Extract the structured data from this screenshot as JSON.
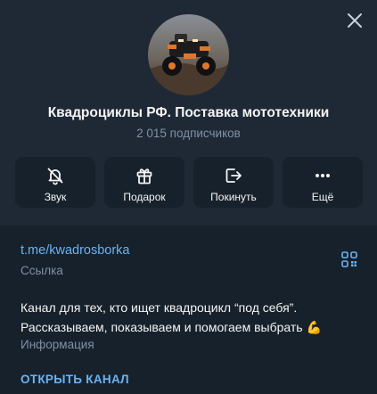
{
  "channel": {
    "title": "Квадроциклы РФ. Поставка мототехники",
    "subscribers": "2 015 подписчиков"
  },
  "actions": [
    {
      "label": "Звук",
      "icon": "bell-off-icon"
    },
    {
      "label": "Подарок",
      "icon": "gift-icon"
    },
    {
      "label": "Покинуть",
      "icon": "leave-icon"
    },
    {
      "label": "Ещё",
      "icon": "more-icon"
    }
  ],
  "info": {
    "link": "t.me/kwadrosborka",
    "link_label": "Ссылка",
    "description_line1": "Канал для тех, кто ищет квадроцикл “под себя”.",
    "description_line2": "Рассказываем, показываем и помогаем выбрать",
    "description_emoji": "💪",
    "description_label": "Информация",
    "open_button": "ОТКРЫТЬ КАНАЛ"
  },
  "colors": {
    "background": "#17212b",
    "header": "#1f2936",
    "accent": "#6ab3f3",
    "muted": "#7f91a4"
  }
}
